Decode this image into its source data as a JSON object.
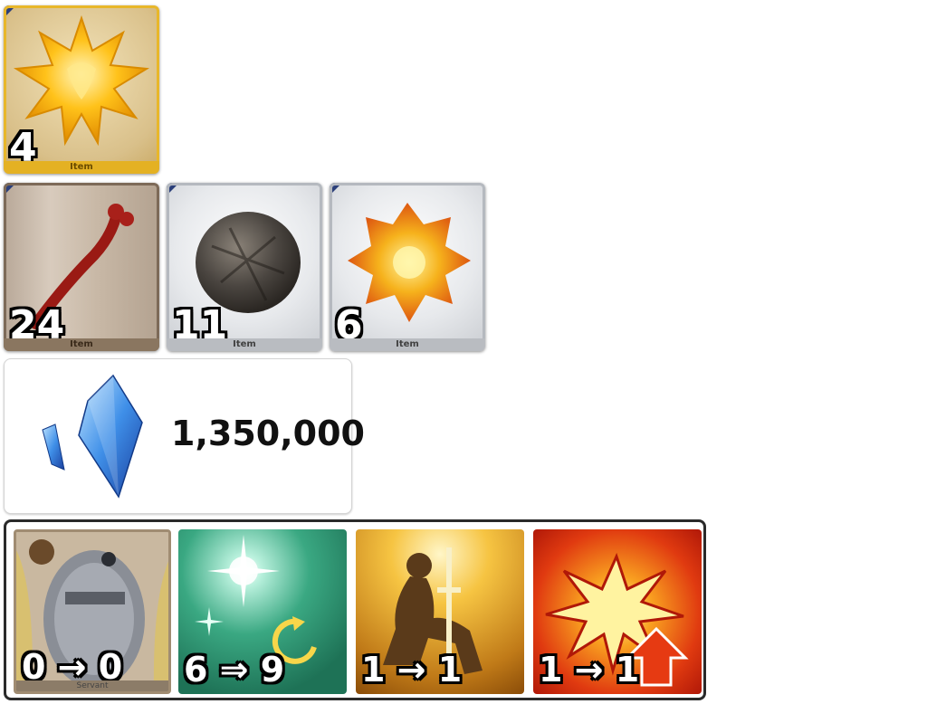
{
  "reward_items": [
    {
      "count": "4",
      "label": "Item",
      "icon": "golden-star-crystal-icon",
      "rarity_color": "#e4b123"
    },
    {
      "count": "24",
      "label": "Item",
      "icon": "red-bone-icon",
      "rarity_color": "#8a7660"
    },
    {
      "count": "11",
      "label": "Item",
      "icon": "stone-seed-icon",
      "rarity_color": "#b9bcc1"
    },
    {
      "count": "6",
      "label": "Item",
      "icon": "phoenix-feather-cluster-icon",
      "rarity_color": "#b9bcc1"
    }
  ],
  "qp": {
    "value": "1,350,000",
    "icon": "blue-crystal-icon"
  },
  "skills": {
    "servant": {
      "change": "0 → 0",
      "label": "Servant",
      "icon": "masked-servant-portrait"
    },
    "skill1": {
      "change": "6 ⇒ 9",
      "icon": "sparkle-heal-icon"
    },
    "skill2": {
      "change": "1 → 1",
      "icon": "kneeling-knight-icon"
    },
    "skill3": {
      "change": "1 → 1",
      "icon": "burst-up-icon"
    }
  }
}
